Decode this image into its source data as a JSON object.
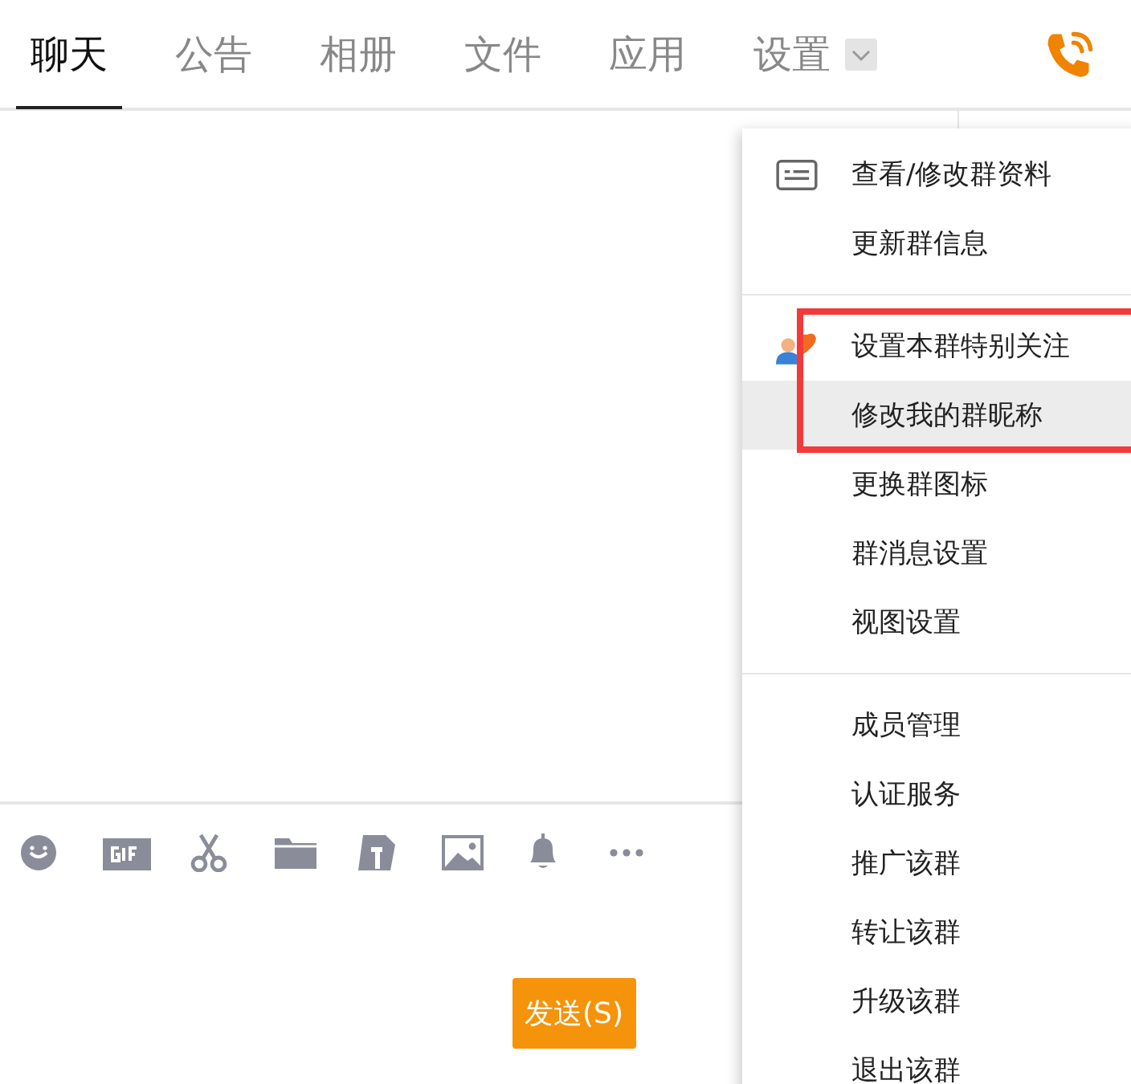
{
  "tabs": [
    {
      "label": "聊天",
      "selected": true
    },
    {
      "label": "公告",
      "selected": false
    },
    {
      "label": "相册",
      "selected": false
    },
    {
      "label": "文件",
      "selected": false
    },
    {
      "label": "应用",
      "selected": false
    },
    {
      "label": "设置",
      "selected": false,
      "dropdown": true
    }
  ],
  "toolbar": [
    {
      "kind": "emoji"
    },
    {
      "kind": "gif"
    },
    {
      "kind": "scissors"
    },
    {
      "kind": "folder"
    },
    {
      "kind": "doc"
    },
    {
      "kind": "image"
    },
    {
      "kind": "bell"
    },
    {
      "kind": "more"
    }
  ],
  "send_button": {
    "label": "发送(S)"
  },
  "menu": {
    "groups": [
      [
        {
          "label": "查看/修改群资料",
          "kind": "card",
          "selected": false
        },
        {
          "label": "更新群信息",
          "selected": false
        }
      ],
      [
        {
          "label": "设置本群特别关注",
          "kind": "person-heart",
          "selected": false,
          "highlighted": true
        },
        {
          "label": "修改我的群昵称",
          "selected": true,
          "highlighted": true
        },
        {
          "label": "更换群图标",
          "selected": false
        },
        {
          "label": "群消息设置",
          "selected": false
        },
        {
          "label": "视图设置",
          "selected": false
        }
      ],
      [
        {
          "label": "成员管理",
          "selected": false
        },
        {
          "label": "认证服务",
          "selected": false
        },
        {
          "label": "推广该群",
          "selected": false
        },
        {
          "label": "转让该群",
          "selected": false
        },
        {
          "label": "升级该群",
          "selected": false
        },
        {
          "label": "退出该群",
          "selected": false
        }
      ]
    ]
  }
}
